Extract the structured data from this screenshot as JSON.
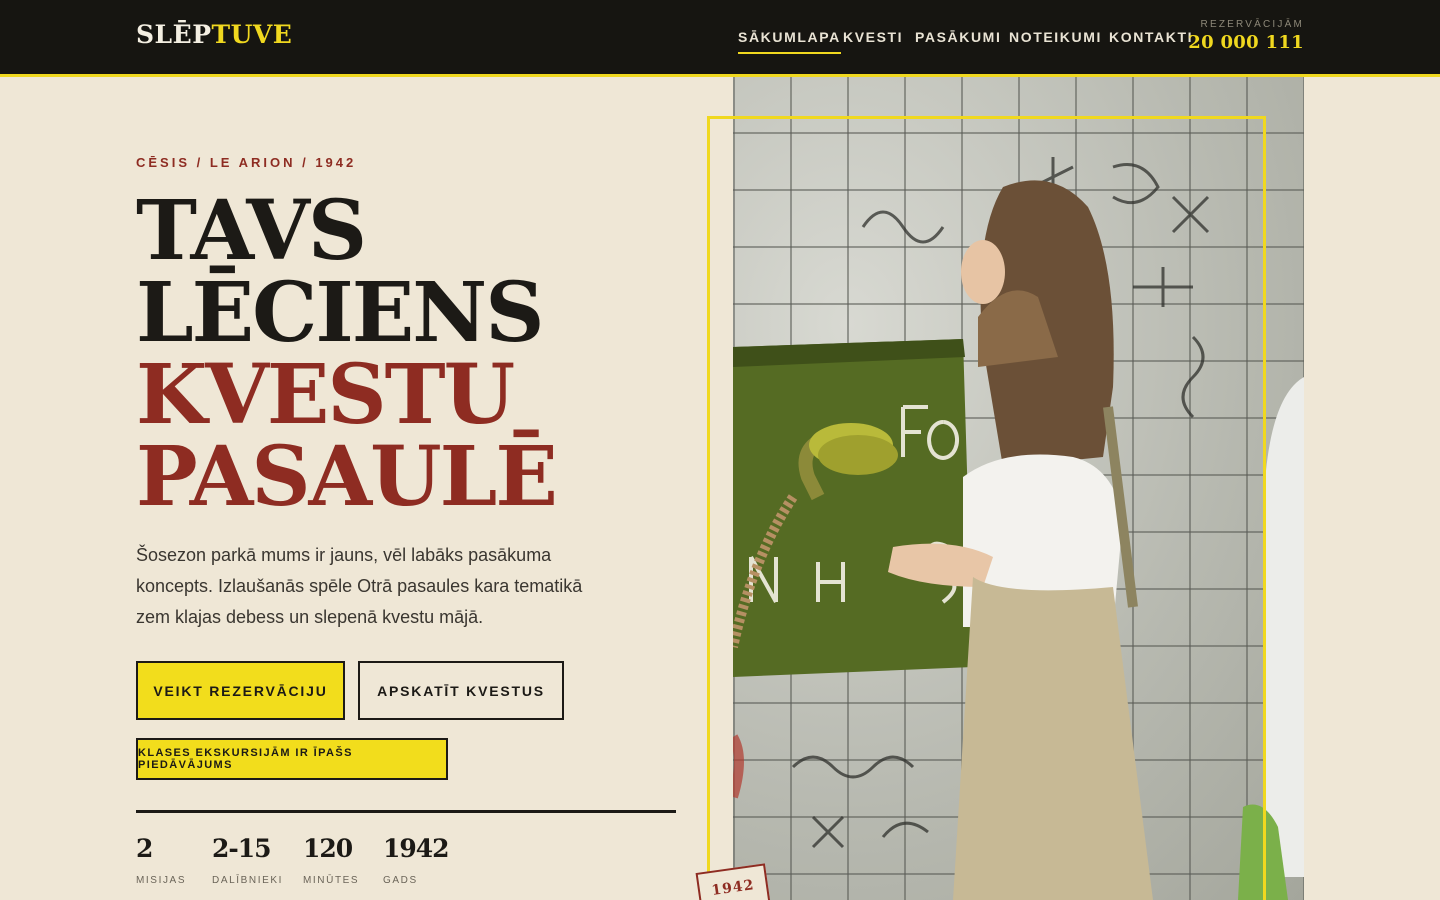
{
  "header": {
    "logo_part1": "SLĒP",
    "logo_part2": "TUVE",
    "nav": [
      "SĀKUMLAPA",
      "KVESTI",
      "PASĀKUMI",
      "NOTEIKUMI",
      "KONTAKTI"
    ],
    "active_nav": "SĀKUMLAPA",
    "reservation_label": "REZERVĀCIJĀM",
    "reservation_phone": "20 000 111"
  },
  "hero": {
    "kicker": "CĒSIS / LE ARION / 1942",
    "title_lines": [
      "TAVS",
      "LĒCIENS",
      "KVESTU",
      "PASAULĒ"
    ],
    "lead": "Šosezon parkā mums ir jauns, vēl labāks pasākuma koncepts. Izlaušanās spēle Otrā pasaules kara tematikā zem klajas debess un slepenā kvestu mājā.",
    "primary_button": "VEIKT REZERVĀCIJU",
    "secondary_button": "APSKATĪT KVESTUS",
    "offer_button": "KLASES EKSKURSIJĀM IR ĪPAŠS PIEDĀVĀJUMS"
  },
  "stats": [
    {
      "value": "2",
      "label": "MISIJAS"
    },
    {
      "value": "2-15",
      "label": "DALĪBNIEKI"
    },
    {
      "value": "120",
      "label": "MINŪTES"
    },
    {
      "value": "1942",
      "label": "GADS"
    }
  ],
  "photo": {
    "stamp": "1942"
  },
  "colors": {
    "accent_yellow": "#f0d81f",
    "brand_red": "#8e2c22",
    "background": "#efe7d6",
    "header_dark": "#161511"
  }
}
